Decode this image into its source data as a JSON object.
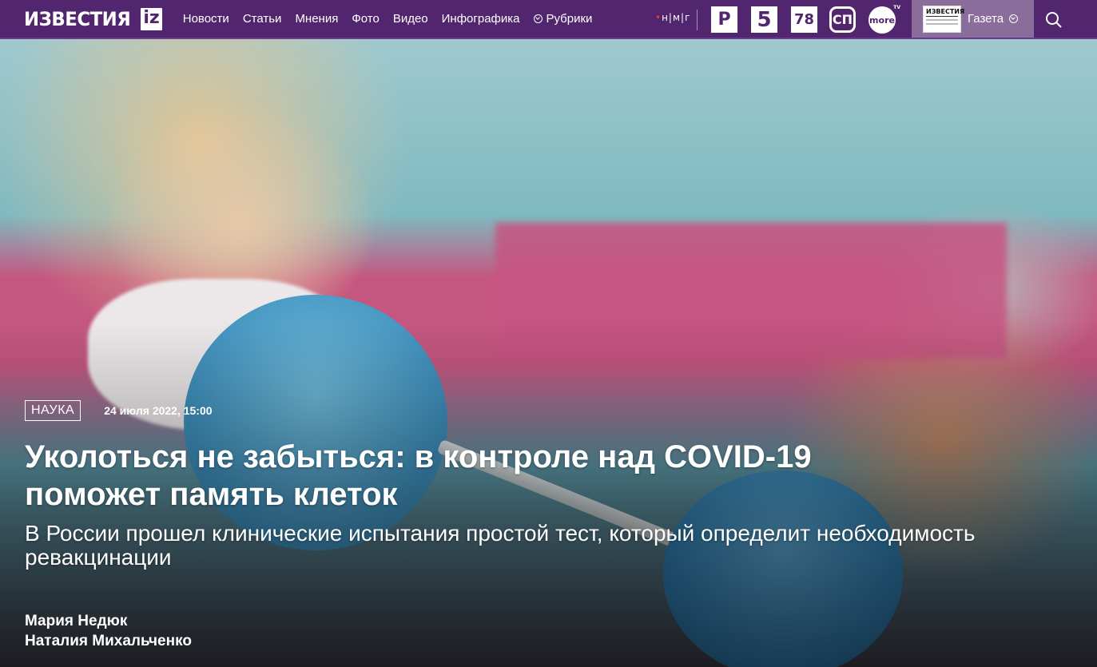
{
  "header": {
    "logo_text": "ИЗВЕСТИЯ",
    "logo_badge": "iz",
    "nav": [
      "Новости",
      "Статьи",
      "Мнения",
      "Фото",
      "Видео",
      "Инфографика"
    ],
    "rubrics_label": "Рубрики",
    "nmg_label": "н|м|г",
    "channels": {
      "ren": "Р",
      "five": "5",
      "seventy_eight": "78",
      "ctc": "СП",
      "more": "more",
      "more_tv": "TV"
    },
    "gazeta_thumb_title": "ИЗВЕСТИЯ",
    "gazeta_label": "Газета",
    "colors": {
      "bar": "#51266f",
      "gazeta_bg": "#8a6d9a"
    },
    "icons": {
      "search": "search-icon",
      "rubrics": "chevron-down-circle-icon"
    }
  },
  "article": {
    "category": "НАУКА",
    "date": "24 июля 2022, 15:00",
    "title": "Уколоться не забыться: в контроле над COVID-19 поможет память клеток",
    "lead": "В России прошел клинические испытания простой тест, который определит необходимость ревакцинации",
    "authors": [
      "Мария Недюк",
      "Наталия Михальченко"
    ]
  }
}
